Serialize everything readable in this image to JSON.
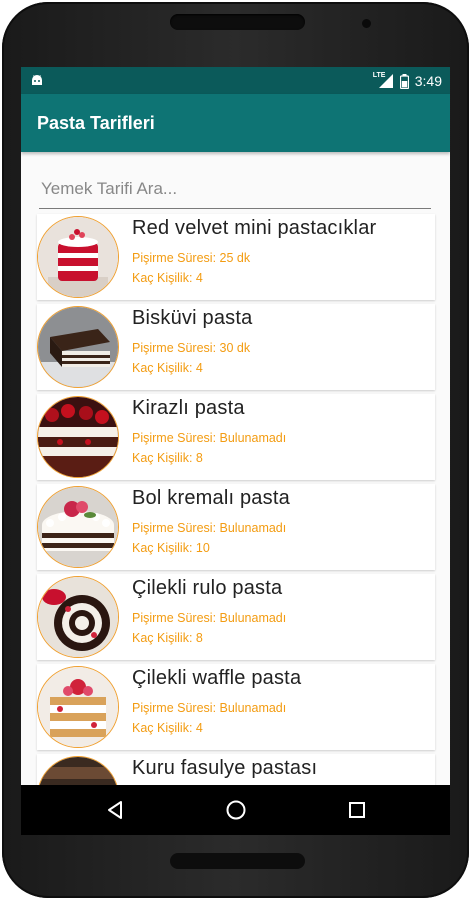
{
  "status_bar": {
    "time": "3:49",
    "network": "LTE"
  },
  "app_bar": {
    "title": "Pasta Tarifleri"
  },
  "search": {
    "placeholder": "Yemek Tarifi Ara..."
  },
  "recipes": [
    {
      "name": "Red velvet mini pastacıklar",
      "time": "Pişirme Süresi: 25 dk",
      "servings": "Kaç Kişilik: 4"
    },
    {
      "name": "Bisküvi pasta",
      "time": "Pişirme Süresi: 30 dk",
      "servings": "Kaç Kişilik: 4"
    },
    {
      "name": "Kirazlı pasta",
      "time": "Pişirme Süresi: Bulunamadı",
      "servings": "Kaç Kişilik: 8"
    },
    {
      "name": "Bol kremalı pasta",
      "time": "Pişirme Süresi: Bulunamadı",
      "servings": "Kaç Kişilik: 10"
    },
    {
      "name": "Çilekli rulo pasta",
      "time": "Pişirme Süresi: Bulunamadı",
      "servings": "Kaç Kişilik: 8"
    },
    {
      "name": "Çilekli waffle pasta",
      "time": "Pişirme Süresi: Bulunamadı",
      "servings": "Kaç Kişilik: 4"
    },
    {
      "name": "Kuru fasulye pastası"
    }
  ],
  "colors": {
    "status_bar": "#0b5a5a",
    "app_bar": "#0e7474",
    "meta_text": "#f39c12",
    "thumb_border": "#f0a030"
  }
}
